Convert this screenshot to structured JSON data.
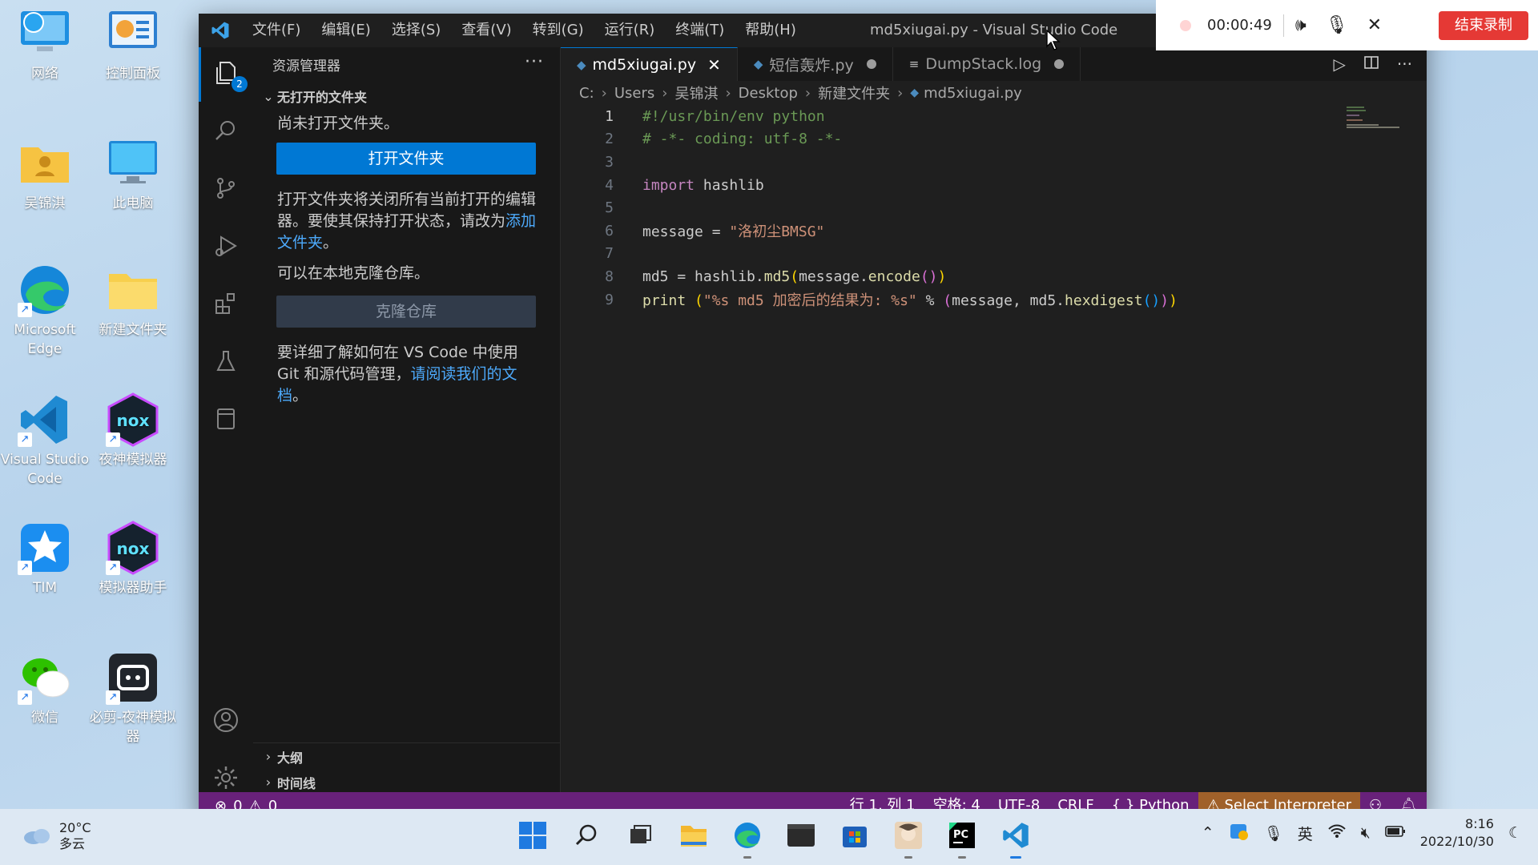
{
  "desktop": {
    "icons": [
      {
        "label": "网络"
      },
      {
        "label": "控制面板"
      },
      {
        "label": "吴锦淇"
      },
      {
        "label": "此电脑"
      },
      {
        "label": "Microsoft Edge"
      },
      {
        "label": "新建文件夹"
      },
      {
        "label": "Visual Studio Code"
      },
      {
        "label": "夜神模拟器"
      },
      {
        "label": "TIM"
      },
      {
        "label": "模拟器助手"
      },
      {
        "label": "微信"
      },
      {
        "label": "必剪-夜神模拟器"
      }
    ]
  },
  "vscode": {
    "menu": [
      "文件(F)",
      "编辑(E)",
      "选择(S)",
      "查看(V)",
      "转到(G)",
      "运行(R)",
      "终端(T)",
      "帮助(H)"
    ],
    "window_title": "md5xiugai.py - Visual Studio Code",
    "explorer_badge": "2",
    "sidebar": {
      "title": "资源管理器",
      "more": "···",
      "section": "无打开的文件夹",
      "no_folder": "尚未打开文件夹。",
      "open_folder_btn": "打开文件夹",
      "explain_1": "打开文件夹将关闭所有当前打开的编辑器。要使其保持打开状态，请改为",
      "add_folder_link": "添加文件夹",
      "explain_end": "。",
      "clone_hint": "可以在本地克隆仓库。",
      "clone_btn": "克隆仓库",
      "learn_1": "要详细了解如何在 VS Code 中使用 Git 和源代码管理，",
      "docs_link": "请阅读我们的文档",
      "learn_end": "。",
      "outline": "大纲",
      "timeline": "时间线"
    },
    "tabs": [
      {
        "label": "md5xiugai.py",
        "state": "close"
      },
      {
        "label": "短信轰炸.py",
        "state": "dirty"
      },
      {
        "label": "DumpStack.log",
        "state": "dirty"
      }
    ],
    "breadcrumb": [
      "C:",
      "Users",
      "吴锦淇",
      "Desktop",
      "新建文件夹",
      "md5xiugai.py"
    ],
    "line_numbers": [
      "1",
      "2",
      "3",
      "4",
      "5",
      "6",
      "7",
      "8",
      "9"
    ],
    "code": {
      "l1": "#!/usr/bin/env python",
      "l2": "# -*- coding: utf-8 -*-",
      "l4_kw": "import",
      "l4_mod": " hashlib",
      "l6_var": "message",
      "l6_eq": " = ",
      "l6_str": "\"洛初尘BMSG\"",
      "l8_var": "md5",
      "l8_eq": " = hashlib.",
      "l8_fn": "md5",
      "l8_arg": "message.",
      "l8_fn2": "encode",
      "l9_fn": "print",
      "l9_str": "\"%s md5 加密后的结果为: %s\"",
      "l9_op": " % ",
      "l9_arg": "message, md5.",
      "l9_fn2": "hexdigest"
    },
    "status": {
      "errors": "0",
      "warnings": "0",
      "position": "行 1, 列 1",
      "spaces": "空格: 4",
      "encoding": "UTF-8",
      "eol": "CRLF",
      "language": "Python",
      "interpreter": "Select Interpreter"
    }
  },
  "recorder": {
    "time": "00:00:49",
    "stop_label": "结束录制"
  },
  "taskbar": {
    "temperature": "20°C",
    "weather": "多云",
    "ime": "英",
    "time": "8:16",
    "date": "2022/10/30"
  }
}
